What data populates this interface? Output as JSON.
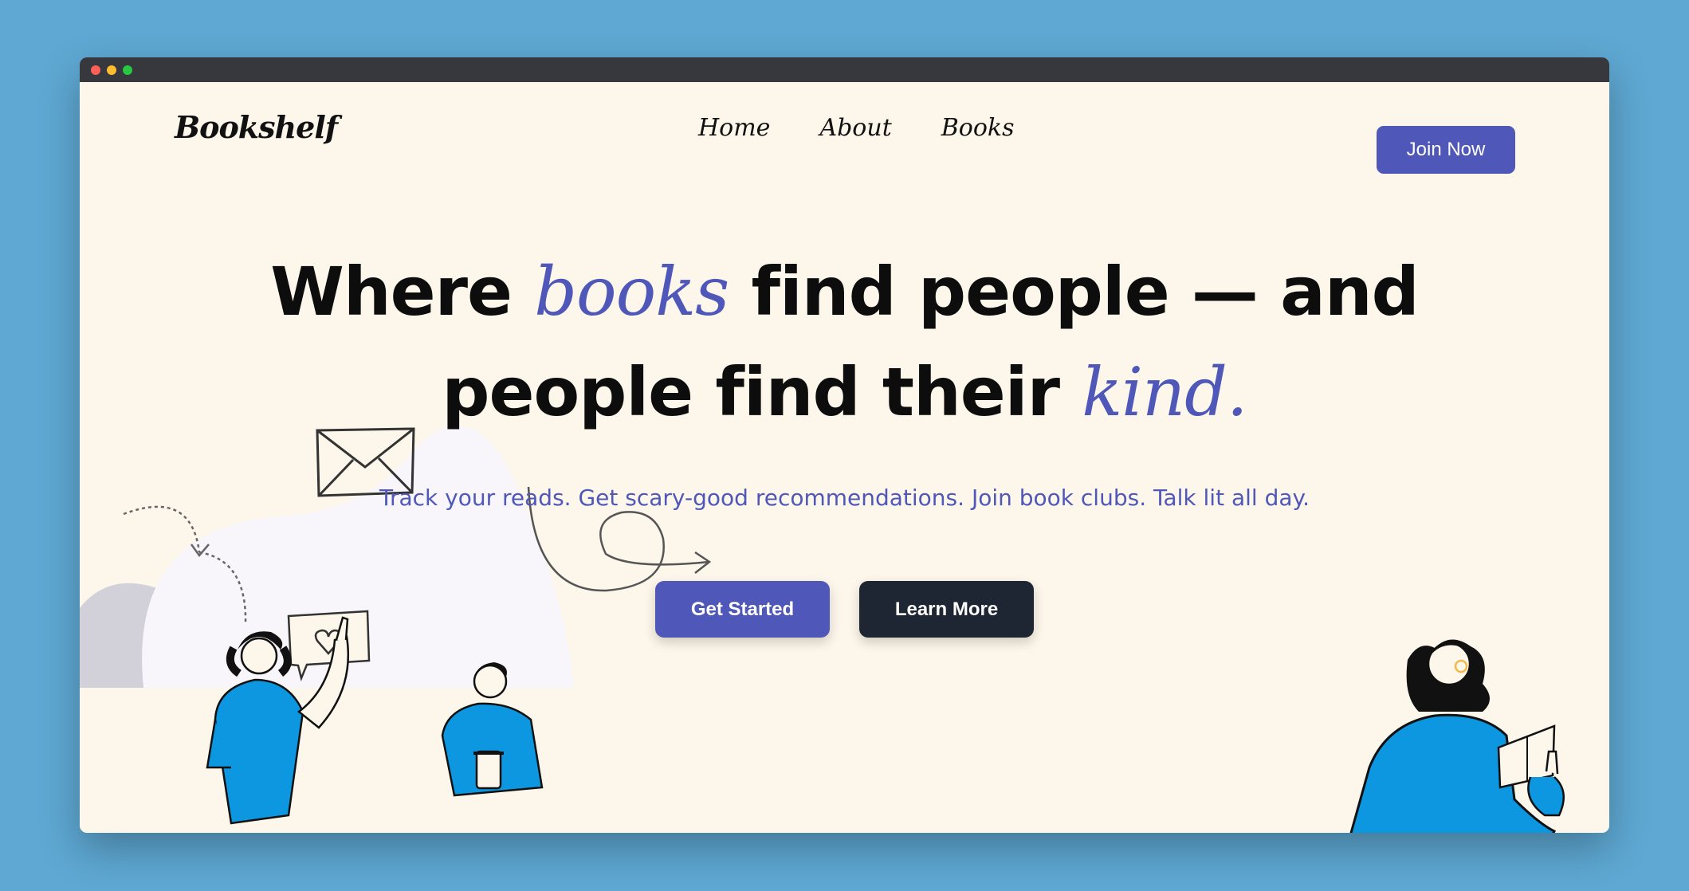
{
  "window": {
    "controls": [
      "close",
      "minimize",
      "maximize"
    ]
  },
  "brand": {
    "logo_text": "Bookshelf",
    "accent_color": "#4f58b8",
    "dark_color": "#1e2533"
  },
  "nav": {
    "items": [
      {
        "label": "Home"
      },
      {
        "label": "About"
      },
      {
        "label": "Books"
      }
    ]
  },
  "header": {
    "join_label": "Join Now"
  },
  "hero": {
    "line1_prefix": "Where ",
    "line1_accent": "books",
    "line1_suffix": " find people — and",
    "line2_prefix": "people find their ",
    "line2_accent": "kind.",
    "subtitle": "Track your reads. Get scary-good recommendations. Join book clubs. Talk lit all day."
  },
  "cta": {
    "primary_label": "Get Started",
    "secondary_label": "Learn More"
  },
  "illustrations": [
    "envelope-icon",
    "arrow-loop-icon",
    "dashed-arrow-icon",
    "heart-speech-bubble-icon",
    "people-illustration",
    "reader-illustration"
  ]
}
